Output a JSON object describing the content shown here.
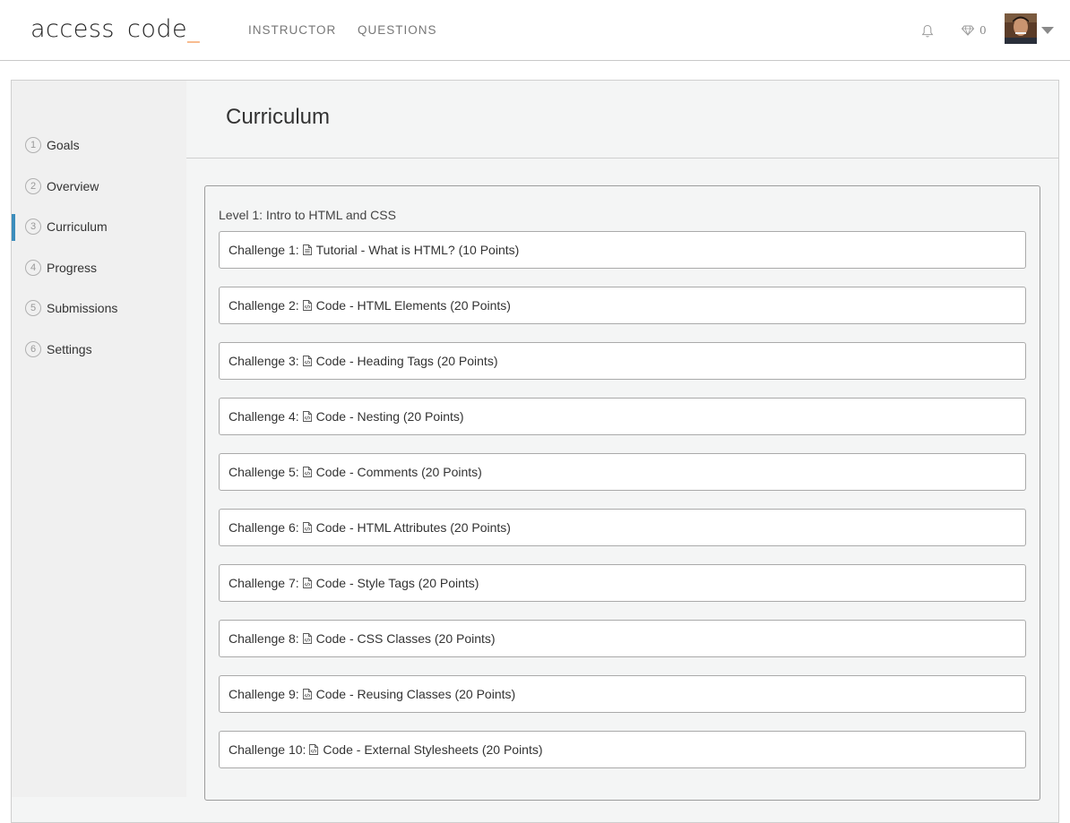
{
  "header": {
    "logo_word1": "access",
    "logo_word2": "code",
    "logo_cursor": "_",
    "nav": [
      "INSTRUCTOR",
      "QUESTIONS"
    ],
    "gem_count": "0",
    "icons": [
      "bell-icon",
      "gem-icon",
      "avatar",
      "caret-down-icon"
    ]
  },
  "sidebar": {
    "items": [
      {
        "num": "1",
        "label": "Goals"
      },
      {
        "num": "2",
        "label": "Overview"
      },
      {
        "num": "3",
        "label": "Curriculum",
        "active": true
      },
      {
        "num": "4",
        "label": "Progress"
      },
      {
        "num": "5",
        "label": "Submissions"
      },
      {
        "num": "6",
        "label": "Settings"
      }
    ]
  },
  "main": {
    "title": "Curriculum",
    "level_title": "Level 1: Intro to HTML and CSS",
    "challenges": [
      {
        "prefix": "Challenge 1:",
        "icon": "document-icon",
        "text": "Tutorial - What is HTML? (10 Points)"
      },
      {
        "prefix": "Challenge 2:",
        "icon": "code-file-icon",
        "text": "Code - HTML Elements (20 Points)"
      },
      {
        "prefix": "Challenge 3:",
        "icon": "code-file-icon",
        "text": "Code - Heading Tags (20 Points)"
      },
      {
        "prefix": "Challenge 4:",
        "icon": "code-file-icon",
        "text": "Code - Nesting (20 Points)"
      },
      {
        "prefix": "Challenge 5:",
        "icon": "code-file-icon",
        "text": "Code - Comments (20 Points)"
      },
      {
        "prefix": "Challenge 6:",
        "icon": "code-file-icon",
        "text": "Code - HTML Attributes (20 Points)"
      },
      {
        "prefix": "Challenge 7:",
        "icon": "code-file-icon",
        "text": "Code - Style Tags (20 Points)"
      },
      {
        "prefix": "Challenge 8:",
        "icon": "code-file-icon",
        "text": "Code - CSS Classes (20 Points)"
      },
      {
        "prefix": "Challenge 9:",
        "icon": "code-file-icon",
        "text": "Code - Reusing Classes (20 Points)"
      },
      {
        "prefix": "Challenge 10:",
        "icon": "code-file-icon",
        "text": "Code - External Stylesheets (20 Points)"
      }
    ]
  },
  "colors": {
    "accent": "#3c8dbc",
    "logo_cursor": "#f07a22"
  }
}
